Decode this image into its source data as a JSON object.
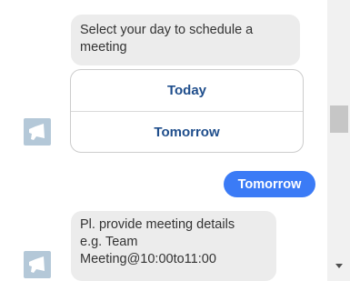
{
  "messages": {
    "bot_prompt_1": "Select your day to schedule a meeting",
    "options": [
      "Today",
      "Tomorrow"
    ],
    "user_reply": "Tomorrow",
    "bot_prompt_2_lines": [
      "Pl. provide meeting details",
      "e.g. Team",
      "Meeting@10:00to11:00"
    ]
  },
  "icons": {
    "bot_avatar": "bot-avatar-icon",
    "scroll_down": "chevron-down-icon"
  },
  "colors": {
    "bot_bubble": "#ececec",
    "user_bubble": "#3b7bf6",
    "option_text": "#1f4e8c",
    "avatar": "#b4c8d8"
  }
}
